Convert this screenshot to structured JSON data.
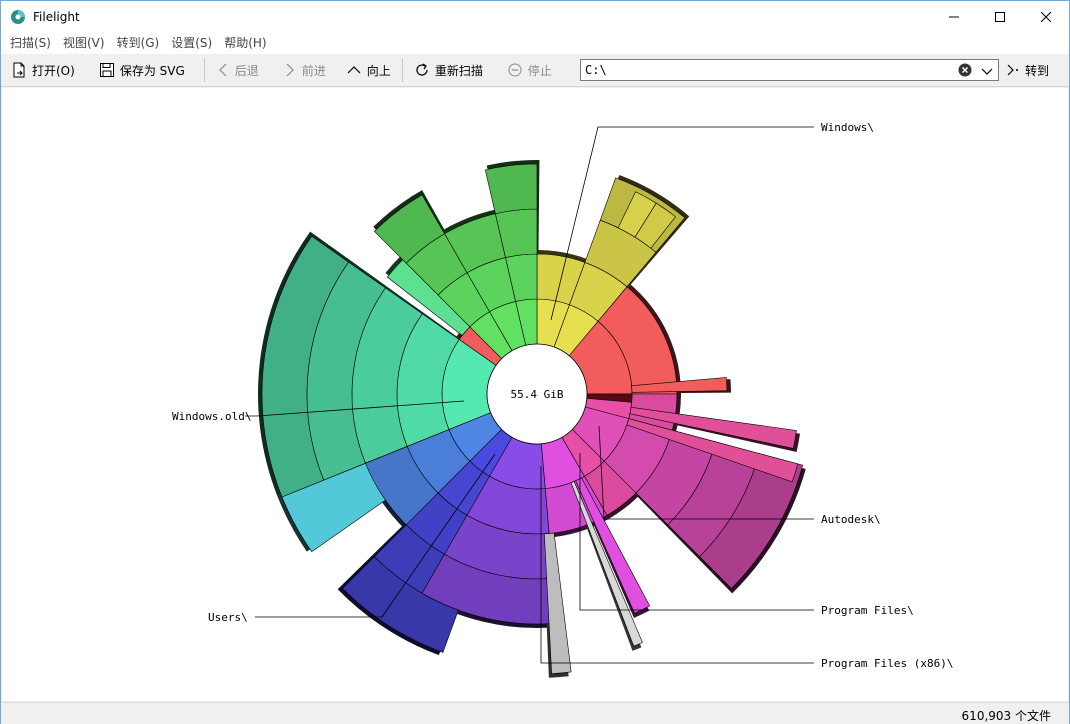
{
  "window": {
    "title": "Filelight"
  },
  "menu": [
    {
      "label": "扫描(S)"
    },
    {
      "label": "视图(V)"
    },
    {
      "label": "转到(G)"
    },
    {
      "label": "设置(S)"
    },
    {
      "label": "帮助(H)"
    }
  ],
  "toolbar": {
    "open_label": "打开(O)",
    "save_svg_label": "保存为 SVG",
    "back_label": "后退",
    "forward_label": "前进",
    "up_label": "向上",
    "rescan_label": "重新扫描",
    "stop_label": "停止",
    "path_value": "C:\\",
    "goto_label": "转到"
  },
  "chart": {
    "center_label": "55.4 GiB",
    "labels": {
      "windows": "Windows\\",
      "windows_old": "Windows.old\\",
      "users": "Users\\",
      "autodesk": "Autodesk\\",
      "program_files": "Program Files\\",
      "program_files_x86": "Program Files (x86)\\"
    }
  },
  "status": {
    "file_count": "610,903 个文件"
  },
  "colors": {
    "windows": "#f25c5c",
    "yellow": "#e6e050",
    "green": "#62e062",
    "teal": "#55e8b0",
    "blue": "#4f86e6",
    "indigo": "#4a4ae0",
    "purple": "#8a4ce6",
    "magenta": "#e050e0",
    "pink": "#e850a8"
  }
}
